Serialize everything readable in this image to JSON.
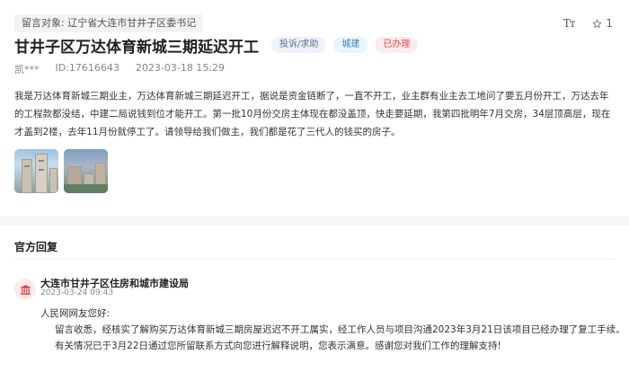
{
  "header": {
    "target_label": "留言对象:",
    "target_value": "辽宁省大连市甘井子区委书记",
    "font_tool": "Tт",
    "star_count": "1"
  },
  "post": {
    "title": "甘井子区万达体育新城三期延迟开工",
    "tags": {
      "type": "投诉/求助",
      "category": "城建",
      "status": "已办理"
    },
    "author": "凯***",
    "id_text": "ID:17616643",
    "datetime": "2023-03-18 15:29",
    "body": "我是万达体育新城三期业主，万达体育新城三期延迟开工，据说是资金链断了，一直不开工，业主群有业主去工地问了要五月份开工，万达去年的工程款都没结，中建二局说钱到位才能开工。第一批10月份交房主体现在都没盖顶，快走要延期，我第四批明年7月交房，34层顶高层，现在才盖到2楼，去年11月份就停工了。请领导给我们做主，我们都是花了三代人的钱买的房子。"
  },
  "official": {
    "section_title": "官方回复",
    "org_name": "大连市甘井子区住房和城市建设局",
    "reply_date": "2023-03-24 09:43",
    "greeting": "人民网网友您好:",
    "line1": "留言收悉，经核实了解购买万达体育新城三期房屋迟迟不开工属实，经工作人员与项目沟通2023年3月21日该项目已经办理了复工手续。",
    "line2": "有关情况已于3月22日通过您所留联系方式向您进行解释说明，您表示满意。感谢您对我们工作的理解支持!"
  },
  "colors": {
    "status_red": "#e0474d",
    "category_blue": "#3d7fb8",
    "org_icon_red": "#e0474d"
  }
}
